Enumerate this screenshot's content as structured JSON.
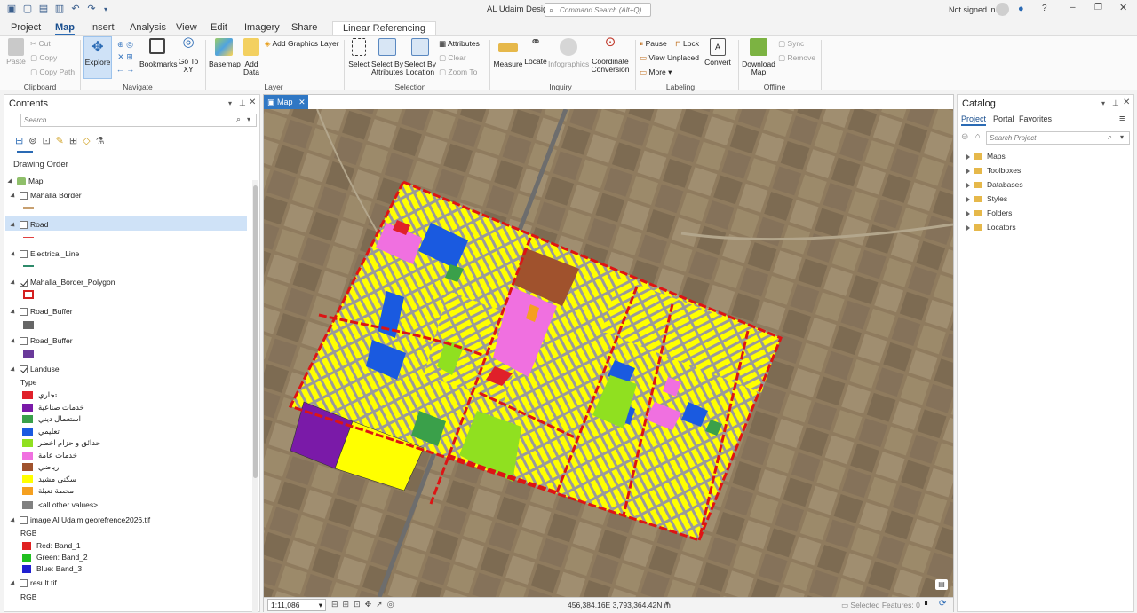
{
  "app": {
    "title": "AL Udaim Design",
    "command_search_placeholder": "Command Search (Alt+Q)",
    "signed_in": "Not signed in"
  },
  "tabs": [
    "Project",
    "Map",
    "Insert",
    "Analysis",
    "View",
    "Edit",
    "Imagery",
    "Share",
    "Linear Referencing"
  ],
  "ribbon": {
    "clipboard": {
      "paste": "Paste",
      "cut": "Cut",
      "copy": "Copy",
      "copy_path": "Copy Path",
      "group": "Clipboard"
    },
    "navigate": {
      "explore": "Explore",
      "bookmarks": "Bookmarks",
      "go_to_xy": "Go To XY",
      "group": "Navigate"
    },
    "layer": {
      "basemap": "Basemap",
      "add_data": "Add Data",
      "add_graphics": "Add Graphics Layer",
      "group": "Layer"
    },
    "selection": {
      "select": "Select",
      "by_attributes": "Select By Attributes",
      "by_location": "Select By Location",
      "attributes": "Attributes",
      "clear": "Clear",
      "zoom_to": "Zoom To",
      "group": "Selection"
    },
    "inquiry": {
      "measure": "Measure",
      "locate": "Locate",
      "infographics": "Infographics",
      "coord_conv": "Coordinate Conversion",
      "group": "Inquiry"
    },
    "labeling": {
      "pause": "Pause",
      "lock": "Lock",
      "view_unplaced": "View Unplaced",
      "more": "More",
      "convert": "Convert",
      "group": "Labeling"
    },
    "offline": {
      "download": "Download Map",
      "sync": "Sync",
      "remove": "Remove",
      "group": "Offline"
    }
  },
  "contents": {
    "title": "Contents",
    "search_placeholder": "Search",
    "drawing_order": "Drawing Order",
    "map_label": "Map",
    "layers": [
      {
        "name": "Mahalla Border",
        "checked": false,
        "color": "#c8a070"
      },
      {
        "name": "Road",
        "checked": false,
        "color": "#e04040"
      },
      {
        "name": "Electrical_Line",
        "checked": false,
        "color": "#2e8a6a"
      },
      {
        "name": "Mahalla_Border_Polygon",
        "checked": true,
        "color": "#d42020"
      },
      {
        "name": "Road_Buffer",
        "checked": false,
        "color": "#666666"
      },
      {
        "name": "Road_Buffer",
        "checked": false,
        "color": "#6a3a9a"
      }
    ],
    "landuse": {
      "name": "Landuse",
      "field": "Type",
      "classes": [
        {
          "label": "تجاري",
          "color": "#e0202a"
        },
        {
          "label": "خدمات صناعية",
          "color": "#7a1aa8"
        },
        {
          "label": "استعمال ديني",
          "color": "#3aa04a"
        },
        {
          "label": "تعليمي",
          "color": "#1a5ae0"
        },
        {
          "label": "حدائق و حزام اخضر",
          "color": "#90e020"
        },
        {
          "label": "خدمات عامة",
          "color": "#f070e0"
        },
        {
          "label": "رياضي",
          "color": "#a0522d"
        },
        {
          "label": "سكني مشيد",
          "color": "#ffff00"
        },
        {
          "label": "محطة تعبئة",
          "color": "#f5a020"
        }
      ],
      "other": "<all other values>"
    },
    "image_layer": {
      "name": "image Al Udaim georefrence2026.tif",
      "rgb": "RGB",
      "bands": [
        {
          "label": "Red:  Band_1",
          "color": "#e02020"
        },
        {
          "label": "Green: Band_2",
          "color": "#20c020"
        },
        {
          "label": "Blue:  Band_3",
          "color": "#2020d0"
        }
      ]
    },
    "result_layer": {
      "name": "result.tif",
      "rgb": "RGB"
    }
  },
  "map": {
    "tab": "Map",
    "scale": "1:11,086",
    "coords": "456,384.16E 3,793,364.42N m",
    "selected": "Selected Features: 0"
  },
  "catalog": {
    "title": "Catalog",
    "tabs": [
      "Project",
      "Portal",
      "Favorites"
    ],
    "search_placeholder": "Search Project",
    "items": [
      "Maps",
      "Toolboxes",
      "Databases",
      "Styles",
      "Folders",
      "Locators"
    ]
  }
}
